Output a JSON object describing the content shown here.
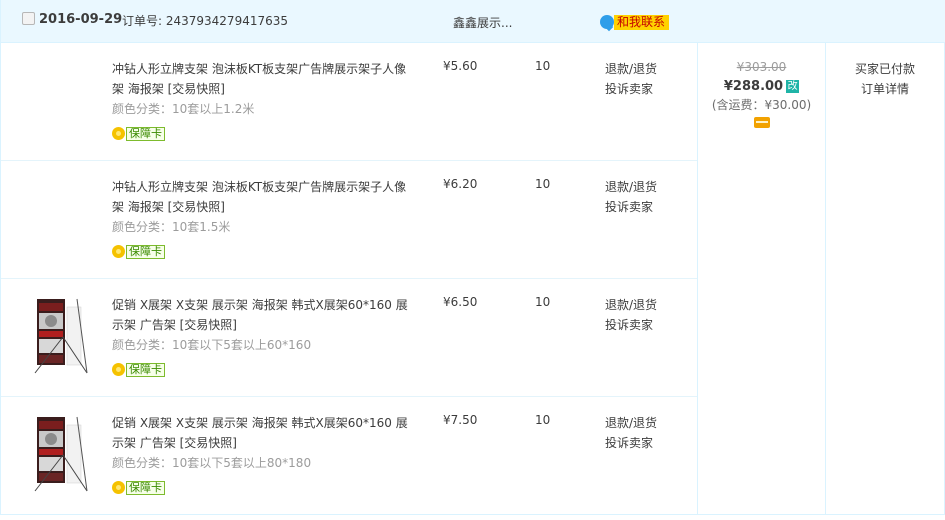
{
  "header": {
    "date": "2016-09-29",
    "order_label": "订单号: 2437934279417635",
    "shop": "鑫鑫展示...",
    "contact": "和我联系"
  },
  "items": [
    {
      "title": "冲钻人形立牌支架 泡沫板KT板支架广告牌展示架子人像架 海报架 [交易快照]",
      "sku": "颜色分类：10套以上1.2米",
      "guarantee": "保障卡",
      "price": "¥5.60",
      "qty": "10",
      "op1": "退款/退货",
      "op2": "投诉卖家",
      "has_image": false
    },
    {
      "title": "冲钻人形立牌支架 泡沫板KT板支架广告牌展示架子人像架 海报架 [交易快照]",
      "sku": "颜色分类：10套1.5米",
      "guarantee": "保障卡",
      "price": "¥6.20",
      "qty": "10",
      "op1": "退款/退货",
      "op2": "投诉卖家",
      "has_image": false
    },
    {
      "title": "促销 X展架 X支架 展示架 海报架 韩式X展架60*160 展示架 广告架 [交易快照]",
      "sku": "颜色分类：10套以下5套以上60*160",
      "guarantee": "保障卡",
      "price": "¥6.50",
      "qty": "10",
      "op1": "退款/退货",
      "op2": "投诉卖家",
      "has_image": true
    },
    {
      "title": "促销 X展架 X支架 展示架 海报架 韩式X展架60*160 展示架 广告架 [交易快照]",
      "sku": "颜色分类：10套以下5套以上80*180",
      "guarantee": "保障卡",
      "price": "¥7.50",
      "qty": "10",
      "op1": "退款/退货",
      "op2": "投诉卖家",
      "has_image": true
    }
  ],
  "total": {
    "original": "¥303.00",
    "paid": "¥288.00",
    "badge": "改",
    "shipping": "(含运费：¥30.00)"
  },
  "status": {
    "state": "买家已付款",
    "detail": "订单详情"
  },
  "colors": {
    "header_bg": "#eaf8ff",
    "border": "#daf3ff",
    "contact_bg": "#ffd200",
    "guarantee_green": "#7dbb2d"
  }
}
